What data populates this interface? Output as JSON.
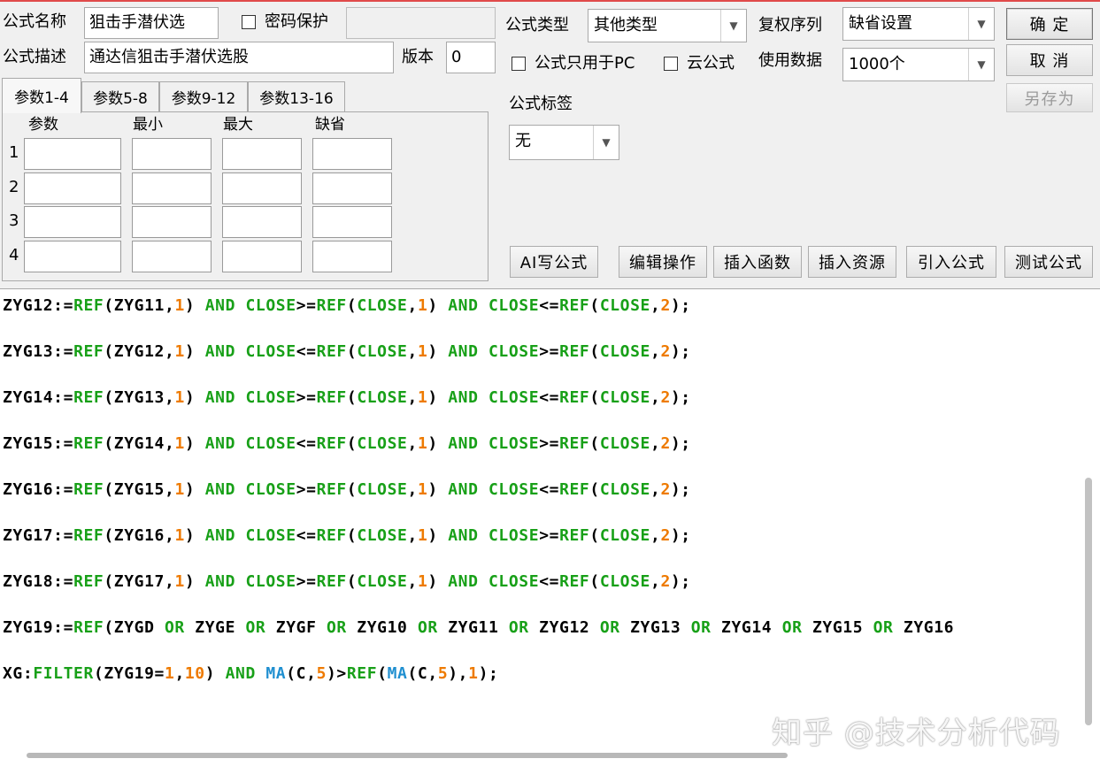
{
  "formula": {
    "name_label": "公式名称",
    "name_value": "狙击手潜伏选",
    "password_label": "密码保护",
    "desc_label": "公式描述",
    "desc_value": "通达信狙击手潜伏选股",
    "version_label": "版本",
    "version_value": "0"
  },
  "tabs": [
    "参数1-4",
    "参数5-8",
    "参数9-12",
    "参数13-16"
  ],
  "params": {
    "headers": [
      "参数",
      "最小",
      "最大",
      "缺省"
    ],
    "rows": [
      "1",
      "2",
      "3",
      "4"
    ]
  },
  "options": {
    "type_label": "公式类型",
    "type_value": "其他类型",
    "rights_label": "复权序列",
    "rights_value": "缺省设置",
    "pc_only_label": "公式只用于PC",
    "cloud_label": "云公式",
    "data_label": "使用数据",
    "data_value": "1000个",
    "tag_label": "公式标签",
    "tag_value": "无"
  },
  "buttons": {
    "ok": "确 定",
    "cancel": "取 消",
    "save_as": "另存为",
    "ai": "AI写公式",
    "edit": "编辑操作",
    "insert_fn": "插入函数",
    "insert_res": "插入资源",
    "import": "引入公式",
    "test": "测试公式"
  },
  "code_lines": [
    "ZYG12:=REF(ZYG11,1) AND CLOSE>=REF(CLOSE,1) AND CLOSE<=REF(CLOSE,2);",
    "ZYG13:=REF(ZYG12,1) AND CLOSE<=REF(CLOSE,1) AND CLOSE>=REF(CLOSE,2);",
    "ZYG14:=REF(ZYG13,1) AND CLOSE>=REF(CLOSE,1) AND CLOSE<=REF(CLOSE,2);",
    "ZYG15:=REF(ZYG14,1) AND CLOSE<=REF(CLOSE,1) AND CLOSE>=REF(CLOSE,2);",
    "ZYG16:=REF(ZYG15,1) AND CLOSE>=REF(CLOSE,1) AND CLOSE<=REF(CLOSE,2);",
    "ZYG17:=REF(ZYG16,1) AND CLOSE<=REF(CLOSE,1) AND CLOSE>=REF(CLOSE,2);",
    "ZYG18:=REF(ZYG17,1) AND CLOSE>=REF(CLOSE,1) AND CLOSE<=REF(CLOSE,2);",
    "ZYG19:=REF(ZYGD OR ZYGE OR ZYGF OR ZYG10 OR ZYG11 OR ZYG12 OR ZYG13 OR ZYG14 OR ZYG15 OR ZYG16",
    "XG:FILTER(ZYG19=1,10) AND MA(C,5)>REF(MA(C,5),1);"
  ],
  "watermark": "知乎 @技术分析代码",
  "colors": {
    "keyword": "#18a018",
    "number": "#ee7a00",
    "ma_function": "#1f8fd0"
  }
}
